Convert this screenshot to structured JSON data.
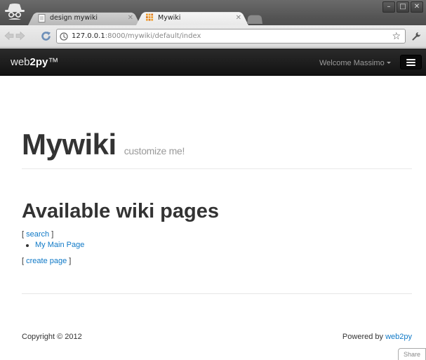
{
  "browser": {
    "tabs": [
      {
        "label": "design mywiki",
        "active": false
      },
      {
        "label": "Mywiki",
        "active": true
      }
    ],
    "address": {
      "host": "127.0.0.1",
      "path": ":8000/mywiki/default/index"
    },
    "window_controls": {
      "minimize": "–",
      "maximize": "□",
      "close": "✕"
    },
    "icons": [
      "incognito-icon",
      "back-icon",
      "forward-icon",
      "reload-icon",
      "site-info-icon",
      "bookmark-star-icon",
      "wrench-icon"
    ]
  },
  "navbar": {
    "brand_prefix": "web",
    "brand_bold": "2py",
    "brand_suffix": "™",
    "welcome": "Welcome Massimo"
  },
  "page": {
    "title": "Mywiki",
    "subtitle": "customize me!",
    "heading": "Available wiki pages",
    "search_open": "[ ",
    "search_link": "search",
    "search_close": " ]",
    "pages": [
      "My Main Page"
    ],
    "create_open": "[ ",
    "create_link": "create page",
    "create_close": " ]"
  },
  "footer": {
    "copyright": "Copyright © 2012",
    "powered_prefix": "Powered by ",
    "powered_link": "web2py"
  },
  "share": {
    "label": "Share"
  },
  "colors": {
    "link": "#0f79c7",
    "navbar": "#1b1b1b",
    "heading": "#333333"
  }
}
